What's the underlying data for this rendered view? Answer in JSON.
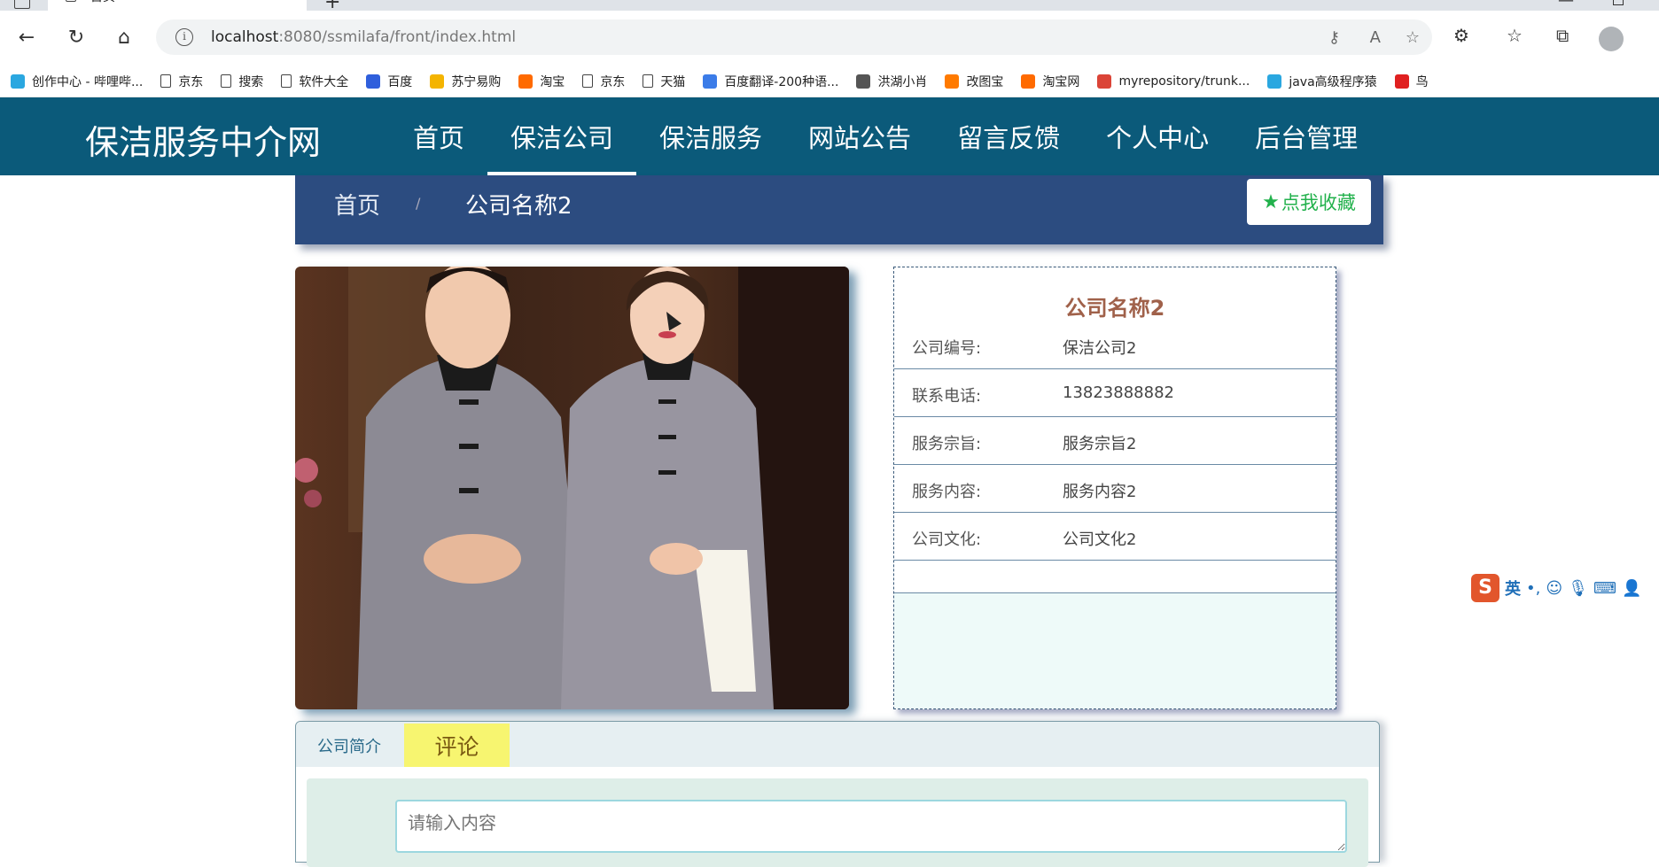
{
  "browser": {
    "tab_title": "首页",
    "url_host": "localhost",
    "url_rest": ":8080/ssmilafa/front/index.html"
  },
  "bookmarks": [
    {
      "label": "创作中心 - 哔哩哔...",
      "icon": "bilibili-icon",
      "color": "#2aa7e0"
    },
    {
      "label": "京东",
      "icon": "page-icon",
      "color": "#444444"
    },
    {
      "label": "搜索",
      "icon": "page-icon",
      "color": "#444444"
    },
    {
      "label": "软件大全",
      "icon": "page-icon",
      "color": "#444444"
    },
    {
      "label": "百度",
      "icon": "baidu-icon",
      "color": "#2f5fdc"
    },
    {
      "label": "苏宁易购",
      "icon": "suning-icon",
      "color": "#f4b400"
    },
    {
      "label": "淘宝",
      "icon": "taobao-icon",
      "color": "#ff6a00"
    },
    {
      "label": "京东",
      "icon": "page-icon",
      "color": "#444444"
    },
    {
      "label": "天猫",
      "icon": "page-icon",
      "color": "#444444"
    },
    {
      "label": "百度翻译-200种语...",
      "icon": "translate-icon",
      "color": "#3b7ce8"
    },
    {
      "label": "洪湖小肖",
      "icon": "bird-icon",
      "color": "#555555"
    },
    {
      "label": "改图宝",
      "icon": "gaitubao-icon",
      "color": "#ff7a00"
    },
    {
      "label": "淘宝网",
      "icon": "taobao-icon",
      "color": "#ff6a00"
    },
    {
      "label": "myrepository/trunk...",
      "icon": "chrome-icon",
      "color": "#db4437"
    },
    {
      "label": "java高级程序猿",
      "icon": "bilibili-icon",
      "color": "#2aa7e0"
    },
    {
      "label": "鸟",
      "icon": "bird-icon",
      "color": "#e02020"
    }
  ],
  "site": {
    "title": "保洁服务中介网",
    "nav": [
      "首页",
      "保洁公司",
      "保洁服务",
      "网站公告",
      "留言反馈",
      "个人中心",
      "后台管理"
    ],
    "active_nav_index": 1,
    "header_color": "#0b5a7a"
  },
  "breadcrumb": {
    "home": "首页",
    "separator": "/",
    "current": "公司名称2",
    "favorite_label": "点我收藏"
  },
  "company": {
    "name": "公司名称2",
    "fields": [
      {
        "label": "公司编号:",
        "value": "保洁公司2"
      },
      {
        "label": "联系电话:",
        "value": "13823888882"
      },
      {
        "label": "服务宗旨:",
        "value": "服务宗旨2"
      },
      {
        "label": "服务内容:",
        "value": "服务内容2"
      },
      {
        "label": "公司文化:",
        "value": "公司文化2"
      }
    ]
  },
  "tabs": {
    "intro": "公司简介",
    "comment": "评论",
    "comment_placeholder": "请输入内容"
  },
  "ime": {
    "lang": "英"
  }
}
